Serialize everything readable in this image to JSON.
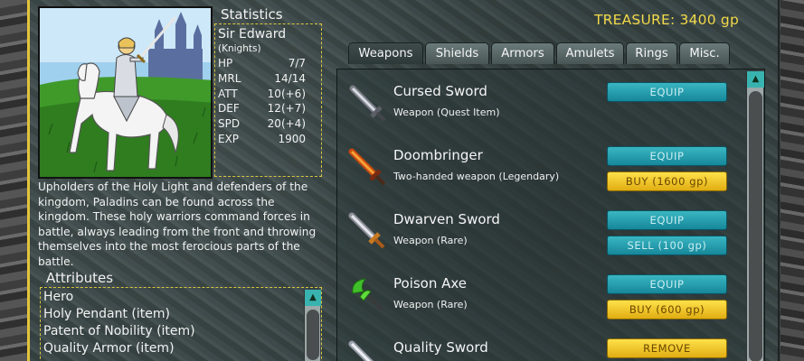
{
  "treasure_label": "TREASURE: 3400 gp",
  "statistics": {
    "title": "Statistics",
    "name": "Sir Edward",
    "group": "(Knights)",
    "rows": [
      {
        "label": "HP",
        "value": "7/7"
      },
      {
        "label": "MRL",
        "value": "14/14"
      },
      {
        "label": "ATT",
        "value": "10(+6)"
      },
      {
        "label": "DEF",
        "value": "12(+7)"
      },
      {
        "label": "SPD",
        "value": "20(+4)"
      },
      {
        "label": "EXP",
        "value": "1900"
      }
    ]
  },
  "description": "Upholders of the Holy Light and defenders of the kingdom, Paladins can be found across the kingdom. These holy warriors command forces in battle, always leading from the front and throwing themselves into the most ferocious parts of the battle.",
  "attributes": {
    "title": "Attributes",
    "items": [
      "Hero",
      "Holy Pendant (item)",
      "Patent of Nobility (item)",
      "Quality Armor (item)"
    ]
  },
  "tabs": [
    "Weapons",
    "Shields",
    "Armors",
    "Amulets",
    "Rings",
    "Misc."
  ],
  "items": [
    {
      "name": "Cursed Sword",
      "kind": "Weapon (Quest Item)",
      "icon": "cursed-sword-icon",
      "buttons": [
        {
          "label": "EQUIP",
          "style": "teal"
        }
      ]
    },
    {
      "name": "Doombringer",
      "kind": "Two-handed weapon (Legendary)",
      "icon": "doombringer-sword-icon",
      "buttons": [
        {
          "label": "EQUIP",
          "style": "teal"
        },
        {
          "label": "BUY (1600 gp)",
          "style": "gold"
        }
      ]
    },
    {
      "name": "Dwarven Sword",
      "kind": "Weapon (Rare)",
      "icon": "dwarven-sword-icon",
      "buttons": [
        {
          "label": "EQUIP",
          "style": "teal"
        },
        {
          "label": "SELL (100 gp)",
          "style": "teal"
        }
      ]
    },
    {
      "name": "Poison Axe",
      "kind": "Weapon (Rare)",
      "icon": "poison-axe-icon",
      "buttons": [
        {
          "label": "EQUIP",
          "style": "teal"
        },
        {
          "label": "BUY (600 gp)",
          "style": "gold"
        }
      ]
    },
    {
      "name": "Quality Sword",
      "kind": "",
      "icon": "quality-sword-icon",
      "buttons": [
        {
          "label": "REMOVE",
          "style": "gold"
        }
      ]
    }
  ],
  "colors": {
    "accent_gold": "#f2d94a",
    "teal_button": "#16879a",
    "gold_button": "#e0ad12",
    "frame": "#d8c640"
  }
}
